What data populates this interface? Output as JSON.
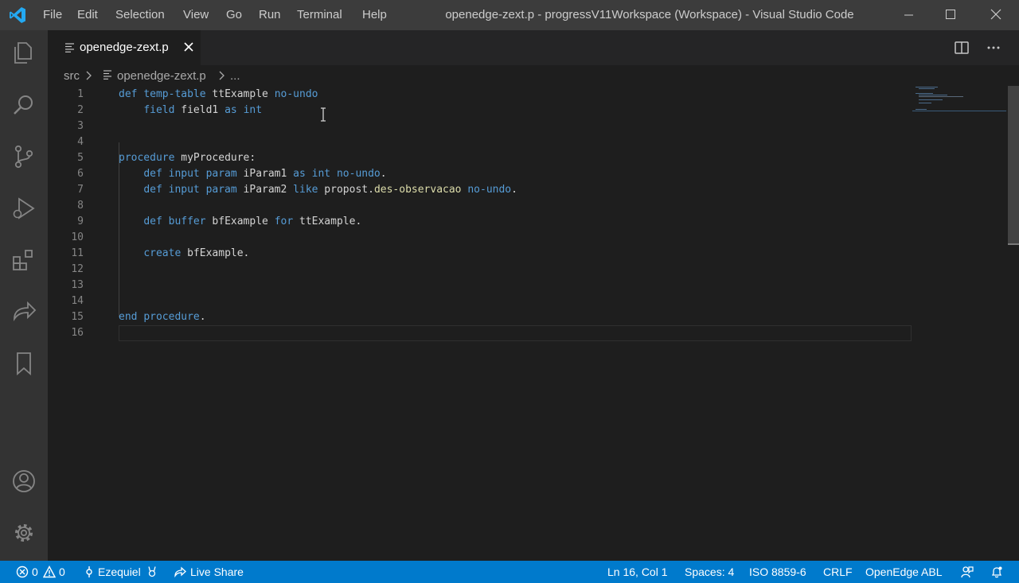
{
  "menu": [
    "File",
    "Edit",
    "Selection",
    "View",
    "Go",
    "Run",
    "Terminal",
    "Help"
  ],
  "window_title": "openedge-zext.p - progressV11Workspace (Workspace) - Visual Studio Code",
  "tab": {
    "label": "openedge-zext.p"
  },
  "breadcrumb": {
    "folder": "src",
    "file": "openedge-zext.p",
    "more": "..."
  },
  "line_numbers": [
    "1",
    "2",
    "3",
    "4",
    "5",
    "6",
    "7",
    "8",
    "9",
    "10",
    "11",
    "12",
    "13",
    "14",
    "15",
    "16"
  ],
  "code": {
    "l1": {
      "a": "def",
      "b": " ",
      "c": "temp-table",
      "d": " ttExample ",
      "e": "no-undo"
    },
    "l2": {
      "a": "    ",
      "b": "field",
      "c": " field1 ",
      "d": "as",
      "e": " ",
      "f": "int"
    },
    "l5": {
      "a": "procedure",
      "b": " myProcedure:"
    },
    "l6": {
      "a": "    ",
      "b": "def input param",
      "c": " iParam1 ",
      "d": "as int no-undo",
      "e": "."
    },
    "l7": {
      "a": "    ",
      "b": "def input param",
      "c": " iParam2 ",
      "d": "like",
      "e": " propost.",
      "f": "des-observacao",
      "g": " ",
      "h": "no-undo",
      "i": "."
    },
    "l9": {
      "a": "    ",
      "b": "def buffer",
      "c": " bfExample ",
      "d": "for",
      "e": " ttExample."
    },
    "l11": {
      "a": "    ",
      "b": "create",
      "c": " bfExample."
    },
    "l15": {
      "a": "end",
      "b": " ",
      "c": "procedure",
      "d": "."
    }
  },
  "status": {
    "errors": "0",
    "warnings": "0",
    "account": "Ezequiel",
    "live_share": "Live Share",
    "position": "Ln 16, Col 1",
    "spaces": "Spaces: 4",
    "encoding": "ISO 8859-6",
    "eol": "CRLF",
    "language": "OpenEdge ABL"
  },
  "colors": {
    "keyword": "#569cd6",
    "function": "#dcdcaa",
    "statusbar": "#007acc",
    "titlebar": "#3c3c3c",
    "activitybar": "#333333"
  }
}
